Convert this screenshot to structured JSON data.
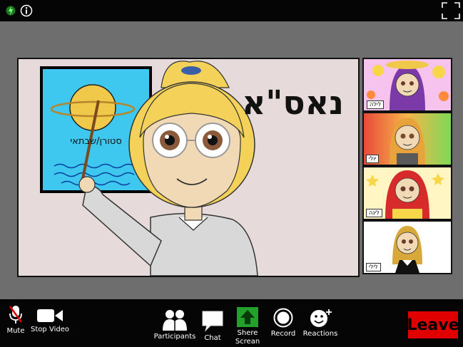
{
  "slide": {
    "title_text": "נאס\"א",
    "poster_caption": "סטורן/שבתאי"
  },
  "participants": [
    {
      "name": "לילה",
      "bg": "#f6c3ee"
    },
    {
      "name": "יולי",
      "bg": "#e94a3a"
    },
    {
      "name": "לינה",
      "bg": "#fff6c4"
    },
    {
      "name": "לילי",
      "bg": "#ffffff"
    }
  ],
  "toolbar": {
    "mute": "Mute",
    "stop_video": "Stop Video",
    "participants": "Participants",
    "chat": "Chat",
    "share_screen_line1": "Shere",
    "share_screen_line2": "Screan",
    "record": "Record",
    "reactions": "Reactions",
    "leave": "Leave"
  },
  "colors": {
    "leave": "#e00000",
    "share_green": "#22a22a",
    "stage_bg": "#e6dada",
    "poster_blue": "#3fc8ef",
    "planet": "#f1c94a"
  },
  "icons": [
    "lightning-icon",
    "info-icon",
    "fullscreen-icon",
    "mute-mic-icon",
    "video-camera-icon",
    "participants-icon",
    "chat-bubble-icon",
    "share-arrow-icon",
    "record-icon",
    "smiley-plus-icon"
  ]
}
